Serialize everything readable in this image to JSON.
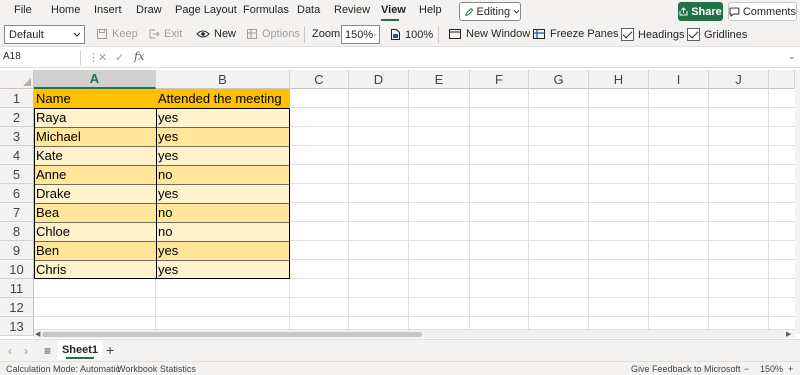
{
  "menu": {
    "items": [
      "File",
      "Home",
      "Insert",
      "Draw",
      "Page Layout",
      "Formulas",
      "Data",
      "Review",
      "View",
      "Help"
    ],
    "active": "View",
    "editing": "Editing",
    "share": "Share",
    "comments": "Comments"
  },
  "ribbon": {
    "sheet_view": "Default",
    "keep": "Keep",
    "exit": "Exit",
    "new": "New",
    "options": "Options",
    "zoom_label": "Zoom",
    "zoom_value": "150%",
    "zoom_100": "100%",
    "new_window": "New Window",
    "freeze_panes": "Freeze Panes",
    "headings": "Headings",
    "gridlines": "Gridlines",
    "headings_checked": true,
    "gridlines_checked": true
  },
  "formula_bar": {
    "name_box": "A18",
    "fx": "fx",
    "value": ""
  },
  "grid": {
    "columns": [
      "A",
      "B",
      "C",
      "D",
      "E",
      "F",
      "G",
      "H",
      "I",
      "J"
    ],
    "selected_column": "A",
    "rows": [
      "1",
      "2",
      "3",
      "4",
      "5",
      "6",
      "7",
      "8",
      "9",
      "10",
      "11",
      "12",
      "13"
    ],
    "header_color": "#ffc000",
    "band_color_light": "#fff2cc",
    "band_color_dark": "#ffe699",
    "table": {
      "headers": [
        "Name",
        "Attended the meeting"
      ],
      "rows": [
        [
          "Raya",
          "yes"
        ],
        [
          "Michael",
          "yes"
        ],
        [
          "Kate",
          "yes"
        ],
        [
          "Anne",
          "no"
        ],
        [
          "Drake",
          "yes"
        ],
        [
          "Bea",
          "no"
        ],
        [
          "Chloe",
          "no"
        ],
        [
          "Ben",
          "yes"
        ],
        [
          "Chris",
          "yes"
        ]
      ]
    }
  },
  "tabs": {
    "sheets": [
      "Sheet1"
    ],
    "add": "+"
  },
  "status": {
    "calc_mode": "Calculation Mode: Automatic",
    "workbook_stats": "Workbook Statistics",
    "feedback": "Give Feedback to Microsoft",
    "zoom_minus": "−",
    "zoom": "150%",
    "zoom_plus": "+"
  }
}
